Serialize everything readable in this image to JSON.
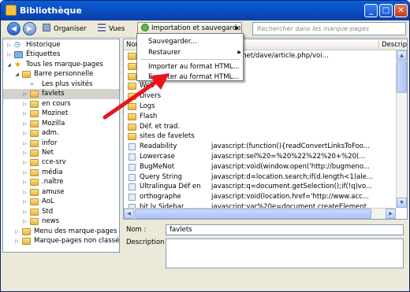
{
  "window": {
    "title": "Bibliothèque",
    "minimize": "_",
    "maximize": "□",
    "close": "✕"
  },
  "toolbar": {
    "back": "◀",
    "forward": "▶",
    "organize_label": "Organiser",
    "views_label": "Vues",
    "import_label": "Importation et sauvegarde",
    "search_placeholder": "Rechercher dans les marque-pages"
  },
  "import_menu": {
    "items": [
      "Sauvegarder...",
      "Restaurer",
      "Importer au format HTML...",
      "Exporter au format HTML..."
    ],
    "submenu_arrow": "▶"
  },
  "tree": {
    "items": [
      {
        "label": "Historique",
        "icon": "history-icon",
        "toggle": "▷"
      },
      {
        "label": "Étiquettes",
        "icon": "tag-icon",
        "toggle": "▷"
      },
      {
        "label": "Tous les marque-pages",
        "icon": "star-icon",
        "toggle": "◢"
      },
      {
        "label": "Barre personnelle",
        "icon": "folder-icon",
        "toggle": "◢"
      },
      {
        "label": "Les plus visités",
        "icon": "smart-folder-icon",
        "toggle": ""
      },
      {
        "label": "favlets",
        "icon": "folder-icon",
        "toggle": "▷"
      },
      {
        "label": "en cours",
        "icon": "folder-icon",
        "toggle": "▷"
      },
      {
        "label": "Mozinet",
        "icon": "folder-icon",
        "toggle": "▷"
      },
      {
        "label": "Mozilla",
        "icon": "folder-icon",
        "toggle": "▷"
      },
      {
        "label": "adm.",
        "icon": "folder-icon",
        "toggle": "▷"
      },
      {
        "label": "infor",
        "icon": "folder-icon",
        "toggle": "▷"
      },
      {
        "label": "Net",
        "icon": "folder-icon",
        "toggle": "▷"
      },
      {
        "label": "cce-srv",
        "icon": "folder-icon",
        "toggle": "▷"
      },
      {
        "label": "média",
        "icon": "folder-icon",
        "toggle": "▷"
      },
      {
        "label": ".naître",
        "icon": "folder-icon",
        "toggle": "▷"
      },
      {
        "label": "amuse",
        "icon": "folder-icon",
        "toggle": "▷"
      },
      {
        "label": "AoL",
        "icon": "folder-icon",
        "toggle": "▷"
      },
      {
        "label": "Std",
        "icon": "folder-icon",
        "toggle": "▷"
      },
      {
        "label": "news",
        "icon": "folder-icon",
        "toggle": "▷"
      },
      {
        "label": "Menu des marque-pages",
        "icon": "folder-icon",
        "toggle": "▷"
      },
      {
        "label": "Marque-pages non classés",
        "icon": "folder-icon",
        "toggle": "▷"
      }
    ],
    "selected": "favlets"
  },
  "list": {
    "columns": [
      "Nom",
      "Description"
    ],
    "rows": [
      {
        "name": "",
        "location": "justdave.net/dave/article.php/voi...",
        "type": "folder"
      },
      {
        "name": "",
        "location": "",
        "type": "folder"
      },
      {
        "name": "",
        "location": "",
        "type": "folder"
      },
      {
        "name": "Web",
        "location": "",
        "type": "folder"
      },
      {
        "name": "Divers",
        "location": "",
        "type": "folder"
      },
      {
        "name": "Logs",
        "location": "",
        "type": "folder"
      },
      {
        "name": "Flash",
        "location": "",
        "type": "folder"
      },
      {
        "name": "Déf. et trad.",
        "location": "",
        "type": "folder"
      },
      {
        "name": "sites de favelets",
        "location": "",
        "type": "folder"
      },
      {
        "name": "Readability",
        "location": "javascript:(function(){readConvertLinksToFoo...",
        "type": "bookmark"
      },
      {
        "name": "Lowercase",
        "location": "javascript:sel%20=%20%22%22%20+%20(...",
        "type": "bookmark"
      },
      {
        "name": "BugMeNot",
        "location": "javascript:void(window.open('http://bugmeno...",
        "type": "bookmark"
      },
      {
        "name": "Query String",
        "location": "javascript:d=location.search;if(d.length<1)ale...",
        "type": "bookmark"
      },
      {
        "name": "Ultralingua Déf en",
        "location": "javascript:q=document.getSelection();if(!q)vo...",
        "type": "bookmark"
      },
      {
        "name": "orthographe",
        "location": "javascript:void(location.href='http://www.acc...",
        "type": "bookmark"
      },
      {
        "name": "bit.ly Sidebar",
        "location": "javascript:var%20e=document.createElement...",
        "type": "bookmark"
      }
    ]
  },
  "details": {
    "name_label": "Nom :",
    "name_value": "favlets",
    "description_label": "Description :",
    "description_value": ""
  },
  "colors": {
    "annotation_arrow": "#e8141b",
    "titlebar": "#0b4fc3"
  }
}
